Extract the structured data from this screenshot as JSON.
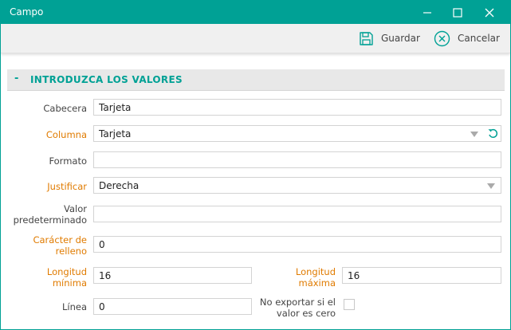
{
  "window": {
    "title": "Campo"
  },
  "toolbar": {
    "save_label": "Guardar",
    "cancel_label": "Cancelar"
  },
  "section": {
    "toggle": "-",
    "title": "INTRODUZCA LOS VALORES"
  },
  "fields": {
    "cabecera": {
      "label": "Cabecera",
      "value": "Tarjeta"
    },
    "columna": {
      "label": "Columna",
      "value": "Tarjeta"
    },
    "formato": {
      "label": "Formato",
      "value": ""
    },
    "justificar": {
      "label": "Justificar",
      "value": "Derecha"
    },
    "valor_pred": {
      "label_line1": "Valor",
      "label_line2": "predeterminado",
      "value": ""
    },
    "caracter": {
      "label_line1": "Carácter de",
      "label_line2": "relleno",
      "value": "0"
    },
    "long_min": {
      "label_line1": "Longitud",
      "label_line2": "mínima",
      "value": "16"
    },
    "long_max": {
      "label_line1": "Longitud",
      "label_line2": "máxima",
      "value": "16"
    },
    "linea": {
      "label": "Línea",
      "value": "0"
    },
    "no_exportar": {
      "label_line1": "No exportar si el",
      "label_line2": "valor es cero",
      "checked": false
    }
  },
  "colors": {
    "accent": "#00a195",
    "required": "#e07b00"
  }
}
